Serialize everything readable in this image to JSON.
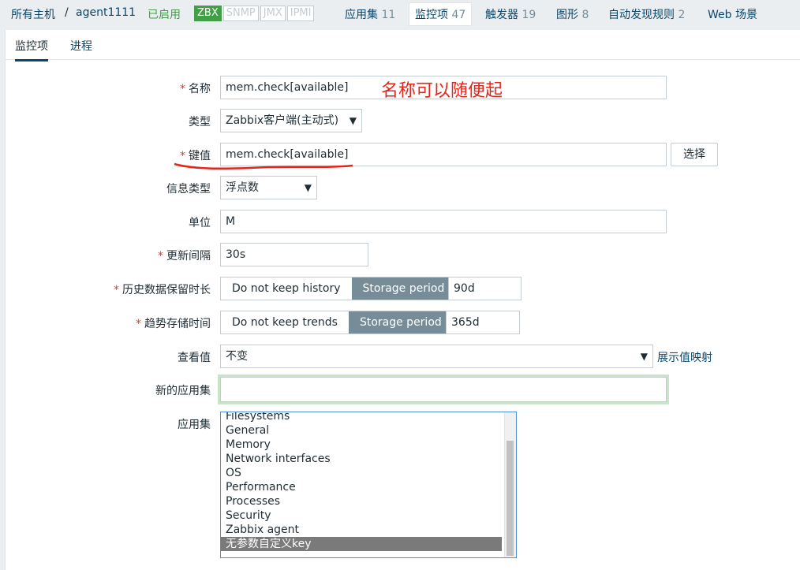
{
  "breadcrumb": {
    "all_hosts": "所有主机",
    "separator": "/",
    "host": "agent1111",
    "status": "已启用"
  },
  "badges": [
    "ZBX",
    "SNMP",
    "JMX",
    "IPMI"
  ],
  "top_nav": [
    {
      "label": "应用集",
      "count": "11"
    },
    {
      "label": "监控项",
      "count": "47"
    },
    {
      "label": "触发器",
      "count": "19"
    },
    {
      "label": "图形",
      "count": "8"
    },
    {
      "label": "自动发现规则",
      "count": "2"
    },
    {
      "label": "Web 场景",
      "count": ""
    }
  ],
  "tabs": [
    "监控项",
    "进程"
  ],
  "form": {
    "name_label": "名称",
    "name_value": "mem.check[available]",
    "annotation": "名称可以随便起",
    "type_label": "类型",
    "type_value": "Zabbix客户端(主动式)",
    "key_label": "键值",
    "key_value": "mem.check[available]",
    "select_button": "选择",
    "info_type_label": "信息类型",
    "info_type_value": "浮点数",
    "units_label": "单位",
    "units_value": "M",
    "interval_label": "更新间隔",
    "interval_value": "30s",
    "history_label": "历史数据保留时长",
    "history_opt1": "Do not keep history",
    "history_opt2": "Storage period",
    "history_value": "90d",
    "trends_label": "趋势存储时间",
    "trends_opt1": "Do not keep trends",
    "trends_opt2": "Storage period",
    "trends_value": "365d",
    "show_value_label": "查看值",
    "show_value_value": "不变",
    "show_value_link": "展示值映射",
    "new_app_label": "新的应用集",
    "new_app_value": "",
    "apps_label": "应用集",
    "apps": [
      "Filesystems",
      "General",
      "Memory",
      "Network interfaces",
      "OS",
      "Performance",
      "Processes",
      "Security",
      "Zabbix agent",
      "无参数自定义key"
    ],
    "apps_selected": "无参数自定义key"
  },
  "colors": {
    "link": "#0a466a",
    "enabled": "#429e47",
    "required": "#e33734",
    "annotation": "#e3261c",
    "segment_active": "#768d99"
  }
}
